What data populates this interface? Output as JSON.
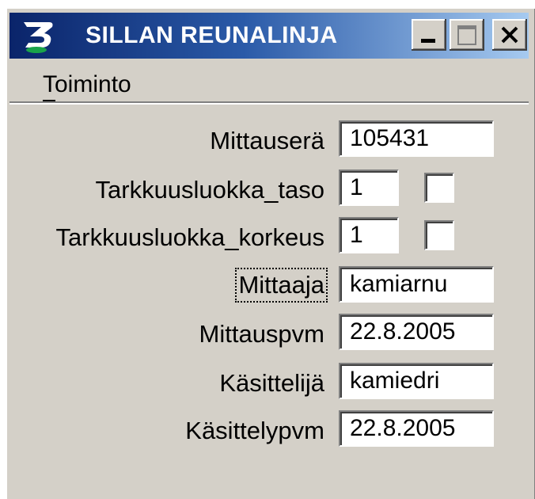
{
  "window": {
    "title": "SILLAN REUNALINJA",
    "titlebar_color_start": "#0a246a",
    "titlebar_color_end": "#a6caf0",
    "icon": "app-logo-icon",
    "controls": {
      "minimize_icon": "minimize-icon",
      "maximize_icon": "maximize-icon",
      "close_icon": "close-icon"
    }
  },
  "menubar": {
    "items": [
      {
        "label": "Toiminto"
      }
    ]
  },
  "form": {
    "mittausera": {
      "label": "Mittauserä",
      "value": "105431"
    },
    "tarkkuus_taso": {
      "label": "Tarkkuusluokka_taso",
      "value": "1",
      "checked": false
    },
    "tarkkuus_korkeus": {
      "label": "Tarkkuusluokka_korkeus",
      "value": "1",
      "checked": false
    },
    "mittaaja": {
      "label": "Mittaaja",
      "value": "kamiarnu"
    },
    "mittauspvm": {
      "label": "Mittauspvm",
      "value": "22.8.2005"
    },
    "kasittelija": {
      "label": "Käsittelijä",
      "value": "kamiedri"
    },
    "kasittelypvm": {
      "label": "Käsittelypvm",
      "value": "22.8.2005"
    }
  }
}
